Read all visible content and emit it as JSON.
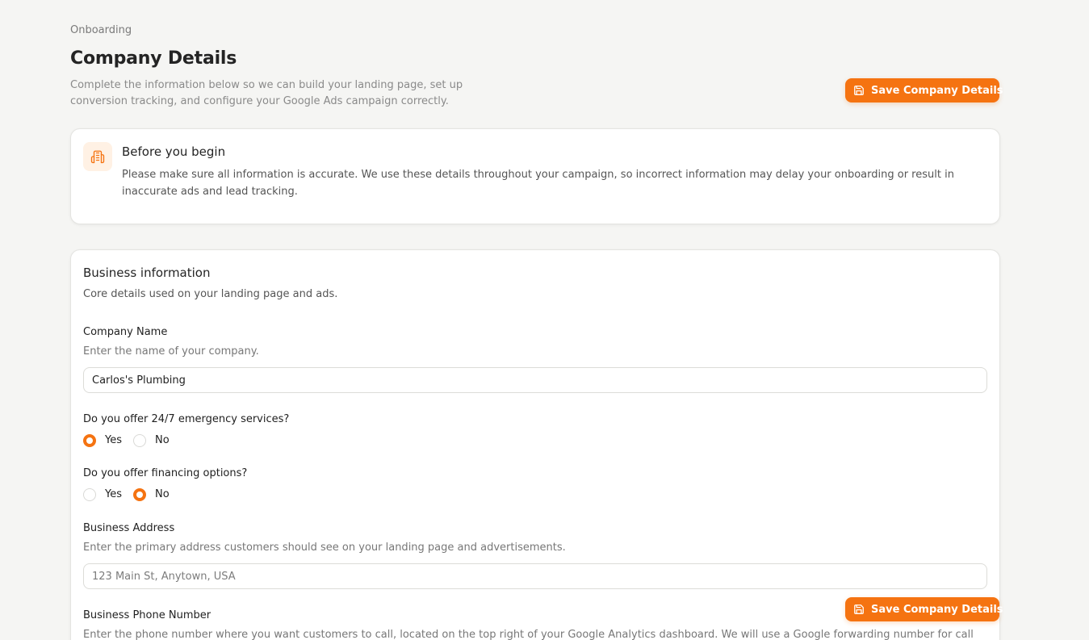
{
  "header": {
    "breadcrumb": "Onboarding",
    "title": "Company Details",
    "subtitle": "Complete the information below so we can build your landing page, set up conversion tracking, and configure your Google Ads campaign correctly.",
    "save_label": "Save Company Details"
  },
  "intro": {
    "icon": "building-icon",
    "title": "Before you begin",
    "text": "Please make sure all information is accurate. We use these details throughout your campaign, so incorrect information may delay your onboarding or result in inaccurate ads and lead tracking."
  },
  "business": {
    "title": "Business information",
    "subtitle": "Core details used on your landing page and ads.",
    "company_name": {
      "label": "Company Name",
      "help": "Enter the name of your company.",
      "value": "Carlos's Plumbing"
    },
    "emergency": {
      "label": "Do you offer 24/7 emergency services?",
      "options": [
        "Yes",
        "No"
      ],
      "selected": "Yes"
    },
    "financing": {
      "label": "Do you offer financing options?",
      "options": [
        "Yes",
        "No"
      ],
      "selected": "No"
    },
    "address": {
      "label": "Business Address",
      "help": "Enter the primary address customers should see on your landing page and advertisements.",
      "placeholder": "123 Main St, Anytown, USA"
    },
    "phone": {
      "label": "Business Phone Number",
      "help": "Enter the phone number where you want customers to call, located on the top right of your Google Analytics dashboard. We will use a Google forwarding number for call"
    }
  },
  "colors": {
    "accent": "#f57311",
    "background": "#f5f5f3",
    "icon_bg": "#fff1e4"
  }
}
